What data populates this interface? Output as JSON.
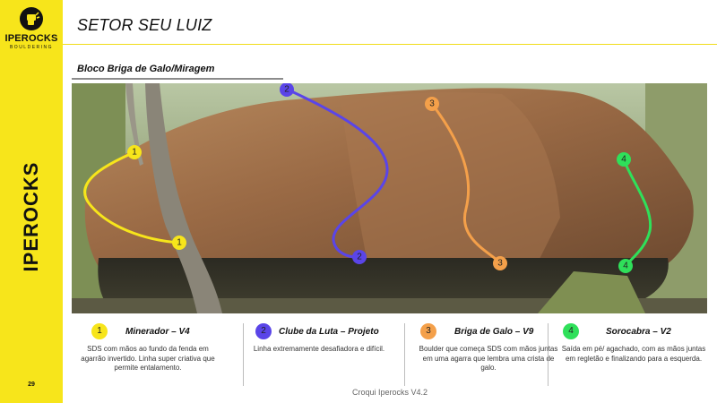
{
  "brand": {
    "logo_name": "IPEROCKS",
    "logo_sub": "BOULDERING",
    "vertical": "IPEROCKS",
    "page_number": "29"
  },
  "header": {
    "title": "SETOR SEU LUIZ",
    "subtitle": "Bloco Briga de Galo/Miragem"
  },
  "colors": {
    "sidebar": "#f7e51b",
    "route_1": "#f7e51b",
    "route_2": "#5a45e8",
    "route_3": "#f4a04a",
    "route_4": "#2fe05a"
  },
  "photo": {
    "markers": [
      {
        "label": "1"
      },
      {
        "label": "1"
      },
      {
        "label": "2"
      },
      {
        "label": "2"
      },
      {
        "label": "3"
      },
      {
        "label": "3"
      },
      {
        "label": "4"
      },
      {
        "label": "4"
      }
    ]
  },
  "routes": [
    {
      "number": "1",
      "name": "Minerador – V4",
      "description": "SDS com mãos ao fundo da fenda em agarrão invertido. Linha super criativa que permite entalamento."
    },
    {
      "number": "2",
      "name": "Clube da Luta – Projeto",
      "description": "Linha extremamente desafiadora e difícil."
    },
    {
      "number": "3",
      "name": "Briga de Galo – V9",
      "description": "Boulder que começa SDS com mãos juntas em uma agarra que lembra uma crista de galo."
    },
    {
      "number": "4",
      "name": "Sorocabra – V2",
      "description": "Saída em pé/ agachado, com as mãos juntas em regletão e finalizando para a esquerda."
    }
  ],
  "footer": "Croqui Iperocks V4.2"
}
